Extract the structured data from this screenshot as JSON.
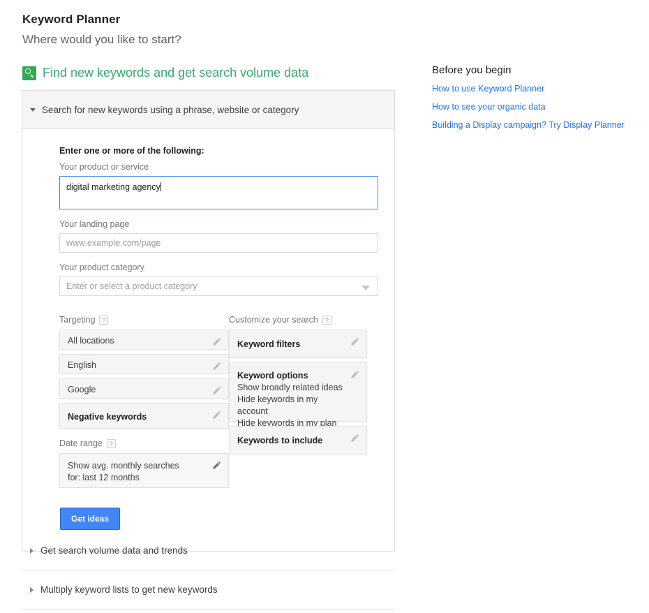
{
  "page": {
    "title": "Keyword Planner",
    "subtitle": "Where would you like to start?"
  },
  "section": {
    "icon": "search-icon",
    "heading": "Find new keywords and get search volume data",
    "accent_color": "#3aa76d"
  },
  "accordion": {
    "expanded": {
      "header": "Search for new keywords using a phrase, website or category",
      "arrow": "chevron-down-icon"
    },
    "collapsed": [
      {
        "label": "Get search volume data and trends",
        "arrow": "chevron-right-icon"
      },
      {
        "label": "Multiply keyword lists to get new keywords",
        "arrow": "chevron-right-icon"
      }
    ]
  },
  "form": {
    "enter_label": "Enter one or more of the following:",
    "product_or_service": {
      "label": "Your product or service",
      "value": "digital marketing agency",
      "placeholder": ""
    },
    "landing_page": {
      "label": "Your landing page",
      "value": "",
      "placeholder": "www.example.com/page"
    },
    "product_category": {
      "label": "Your product category",
      "value": "",
      "placeholder": "Enter or select a product category"
    },
    "submit_label": "Get ideas",
    "submit_color": "#4285f4"
  },
  "targeting": {
    "label": "Targeting",
    "help": "?",
    "items": [
      {
        "label": "All locations",
        "bold": false
      },
      {
        "label": "English",
        "bold": false
      },
      {
        "label": "Google",
        "bold": false
      },
      {
        "label": "Negative keywords",
        "bold": true
      }
    ]
  },
  "date_range": {
    "label": "Date range",
    "help": "?",
    "value_line1": "Show avg. monthly searches",
    "value_line2": "for: last 12 months"
  },
  "customize": {
    "label": "Customize your search",
    "help": "?",
    "cards": [
      {
        "title": "Keyword filters",
        "lines": []
      },
      {
        "title": "Keyword options",
        "lines": [
          "Show broadly related ideas",
          "Hide keywords in my account",
          "Hide keywords in my plan"
        ]
      },
      {
        "title": "Keywords to include",
        "lines": []
      }
    ]
  },
  "rail": {
    "title": "Before you begin",
    "links": [
      "How to use Keyword Planner",
      "How to see your organic data",
      "Building a Display campaign? Try Display Planner"
    ],
    "link_color": "#1a73e8"
  }
}
